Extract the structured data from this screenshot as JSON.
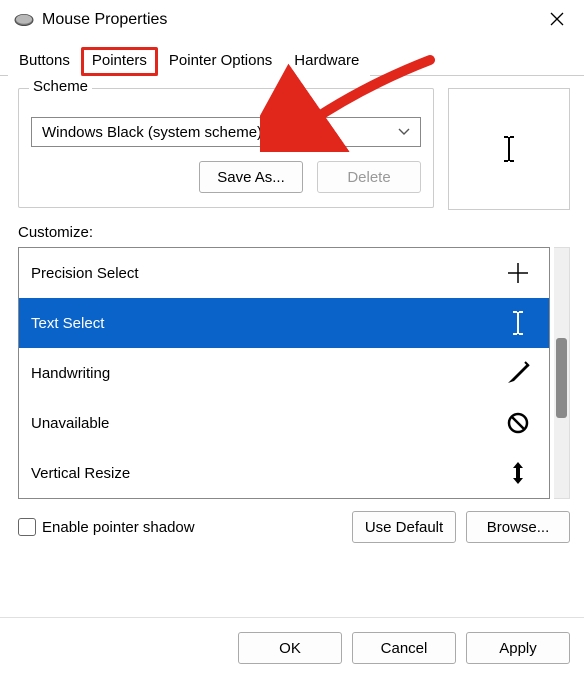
{
  "window": {
    "title": "Mouse Properties"
  },
  "tabs": {
    "buttons": "Buttons",
    "pointers": "Pointers",
    "pointer_options": "Pointer Options",
    "hardware": "Hardware"
  },
  "scheme": {
    "legend": "Scheme",
    "selected": "Windows Black (system scheme)",
    "save_as": "Save As...",
    "delete": "Delete"
  },
  "customize": {
    "label": "Customize:",
    "items": [
      {
        "label": "Precision Select",
        "icon": "plus",
        "selected": false
      },
      {
        "label": "Text Select",
        "icon": "ibeam",
        "selected": true
      },
      {
        "label": "Handwriting",
        "icon": "pen",
        "selected": false
      },
      {
        "label": "Unavailable",
        "icon": "no",
        "selected": false
      },
      {
        "label": "Vertical Resize",
        "icon": "vresize",
        "selected": false
      }
    ]
  },
  "options": {
    "enable_shadow": "Enable pointer shadow",
    "use_default": "Use Default",
    "browse": "Browse..."
  },
  "actions": {
    "ok": "OK",
    "cancel": "Cancel",
    "apply": "Apply"
  }
}
